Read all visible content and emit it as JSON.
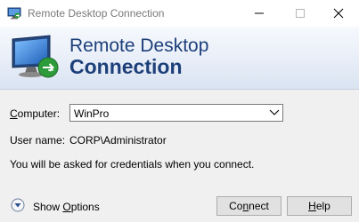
{
  "window": {
    "title": "Remote Desktop Connection"
  },
  "banner": {
    "line1": "Remote Desktop",
    "line2": "Connection"
  },
  "form": {
    "computer_label_mnemonic": "C",
    "computer_label_rest": "omputer:",
    "computer_value": "WinPro",
    "username_label": "User name:",
    "username_value": "CORP\\Administrator",
    "info_text": "You will be asked for credentials when you connect."
  },
  "footer": {
    "show_options_prefix": "Show ",
    "show_options_mnemonic": "O",
    "show_options_suffix": "ptions",
    "connect_prefix": "Co",
    "connect_mnemonic": "n",
    "connect_suffix": "nect",
    "help_mnemonic": "H",
    "help_suffix": "elp"
  },
  "colors": {
    "banner_text": "#1c3f7a",
    "window_bg": "#f0f0f0",
    "button_bg": "#e1e1e1"
  },
  "icons": {
    "app": "remote-desktop-icon",
    "banner": "monitor-remote-icon",
    "minimize": "minimize-icon",
    "maximize": "maximize-icon",
    "close": "close-icon",
    "combo": "chevron-down-icon",
    "options": "expand-options-icon"
  }
}
